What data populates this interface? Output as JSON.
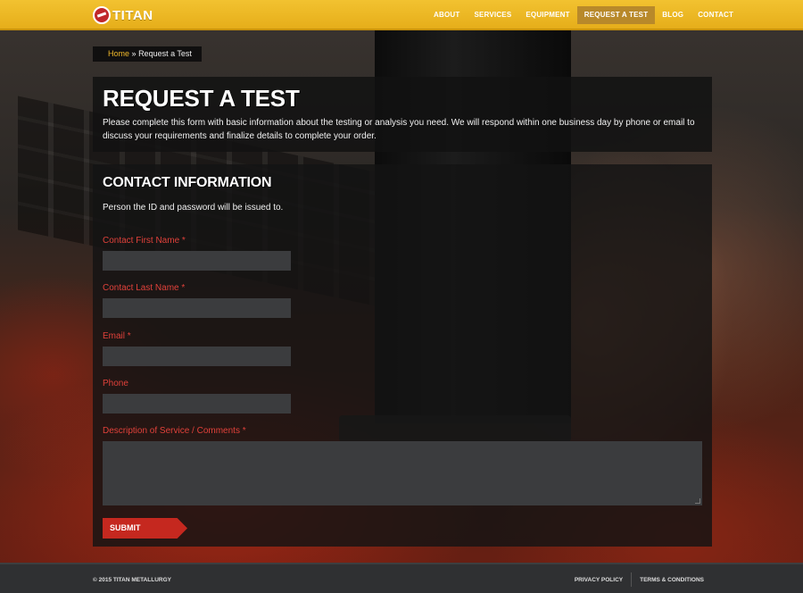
{
  "brand": {
    "name": "TITAN",
    "accent": "#f2c230",
    "cta_color": "#c5281f",
    "label_color": "#e0413a"
  },
  "nav": {
    "items": [
      "ABOUT",
      "SERVICES",
      "EQUIPMENT",
      "REQUEST A TEST",
      "BLOG",
      "CONTACT"
    ],
    "active": "REQUEST A TEST"
  },
  "breadcrumb": {
    "home": "Home",
    "separator": "»",
    "current": "Request a Test"
  },
  "intro": {
    "title": "REQUEST A TEST",
    "text": "Please complete this form with basic information about the testing or analysis you need. We will respond within one business day by phone or email to discuss your requirements and finalize details to complete your order."
  },
  "form": {
    "title": "CONTACT INFORMATION",
    "subtitle": "Person the ID and password will be issued to.",
    "fields": [
      {
        "label": "Contact First Name *",
        "value": ""
      },
      {
        "label": "Contact Last Name *",
        "value": ""
      },
      {
        "label": "Email *",
        "value": ""
      },
      {
        "label": "Phone",
        "value": ""
      }
    ],
    "comments_label": "Description of Service / Comments *",
    "comments_value": "",
    "submit_label": "SUBMIT"
  },
  "footer": {
    "copyright": "© 2015 TITAN METALLURGY",
    "links": [
      "PRIVACY POLICY",
      "TERMS & CONDITIONS"
    ]
  }
}
